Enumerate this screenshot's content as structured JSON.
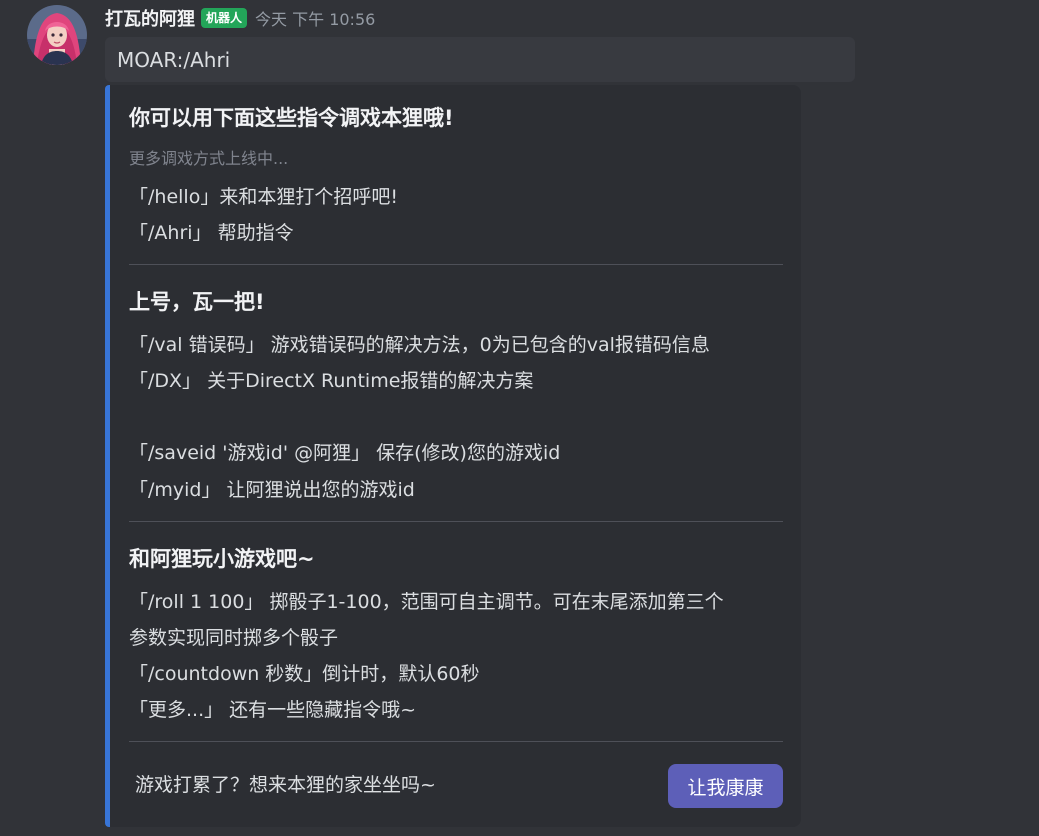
{
  "author": {
    "name": "打瓦的阿狸",
    "tag": "机器人",
    "timestamp": "今天 下午 10:56"
  },
  "message": {
    "content": "MOAR:/Ahri"
  },
  "embed": {
    "section1": {
      "title": "你可以用下面这些指令调戏本狸哦!",
      "subtitle": "更多调戏方式上线中...",
      "lines": [
        "「/hello」来和本狸打个招呼吧!",
        "「/Ahri」 帮助指令"
      ]
    },
    "section2": {
      "title": "上号，瓦一把!",
      "lines": [
        "「/val 错误码」 游戏错误码的解决方法，0为已包含的val报错码信息",
        "「/DX」 关于DirectX Runtime报错的解决方案",
        "「/saveid '游戏id' @阿狸」 保存(修改)您的游戏id",
        "「/myid」 让阿狸说出您的游戏id"
      ]
    },
    "section3": {
      "title": "和阿狸玩小游戏吧~",
      "lines": [
        "「/roll 1 100」 掷骰子1-100，范围可自主调节。可在末尾添加第三个",
        "参数实现同时掷多个骰子",
        "「/countdown 秒数」倒计时，默认60秒",
        "「更多...」 还有一些隐藏指令哦~"
      ]
    },
    "footer": {
      "text": "游戏打累了？想来本狸的家坐坐吗~",
      "button_label": "让我康康"
    }
  },
  "colors": {
    "background": "#313338",
    "embed_bar": "#3875d7",
    "bot_tag": "#23a559",
    "button": "#5d5fb8"
  },
  "icons": {
    "avatar": "avatar-image"
  }
}
